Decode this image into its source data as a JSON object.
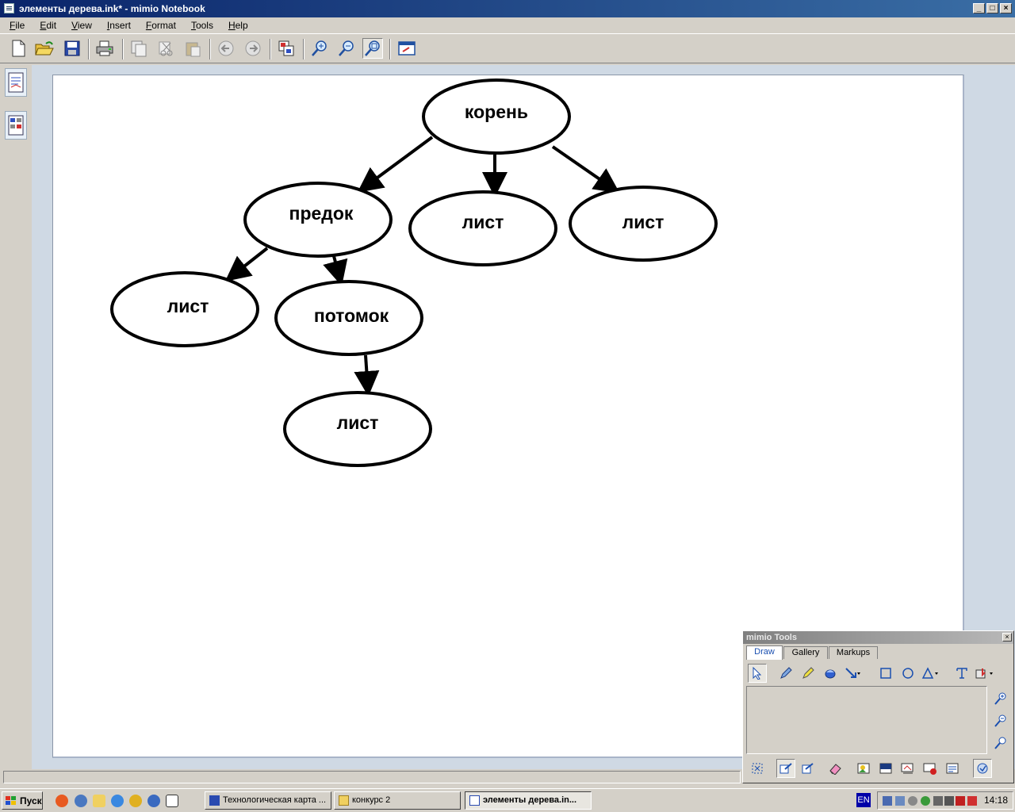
{
  "window": {
    "title": "элементы дерева.ink* - mimio Notebook"
  },
  "menu": [
    "File",
    "Edit",
    "View",
    "Insert",
    "Format",
    "Tools",
    "Help"
  ],
  "toolbar": {
    "buttons": [
      "new-icon",
      "open-icon",
      "save-icon",
      "print-icon",
      "copy-page-icon",
      "cut-icon",
      "paste-icon",
      "back-icon",
      "forward-icon",
      "page-sorter-icon",
      "zoom-in-icon",
      "zoom-out-icon",
      "zoom-fit-icon",
      "fullscreen-icon"
    ]
  },
  "diagram": {
    "nodes": [
      {
        "id": "root",
        "label": "корень"
      },
      {
        "id": "ancestor",
        "label": "предок"
      },
      {
        "id": "leaf1",
        "label": "лист"
      },
      {
        "id": "leaf2",
        "label": "лист"
      },
      {
        "id": "leaf3",
        "label": "лист"
      },
      {
        "id": "descendant",
        "label": "потомок"
      },
      {
        "id": "leaf4",
        "label": "лист"
      }
    ],
    "edges": [
      [
        "root",
        "ancestor"
      ],
      [
        "root",
        "leaf1"
      ],
      [
        "root",
        "leaf2"
      ],
      [
        "ancestor",
        "leaf3"
      ],
      [
        "ancestor",
        "descendant"
      ],
      [
        "descendant",
        "leaf4"
      ]
    ]
  },
  "mimio_tools": {
    "title": "mimio Tools",
    "close": "×",
    "tabs": [
      "Draw",
      "Gallery",
      "Markups"
    ],
    "active_tab": "Draw"
  },
  "taskbar": {
    "start": "Пуск",
    "tasks": [
      {
        "label": "Технологическая карта ...",
        "active": false
      },
      {
        "label": "конкурс 2",
        "active": false
      },
      {
        "label": "элементы дерева.in...",
        "active": true
      }
    ],
    "language": "EN",
    "clock": "14:18"
  }
}
